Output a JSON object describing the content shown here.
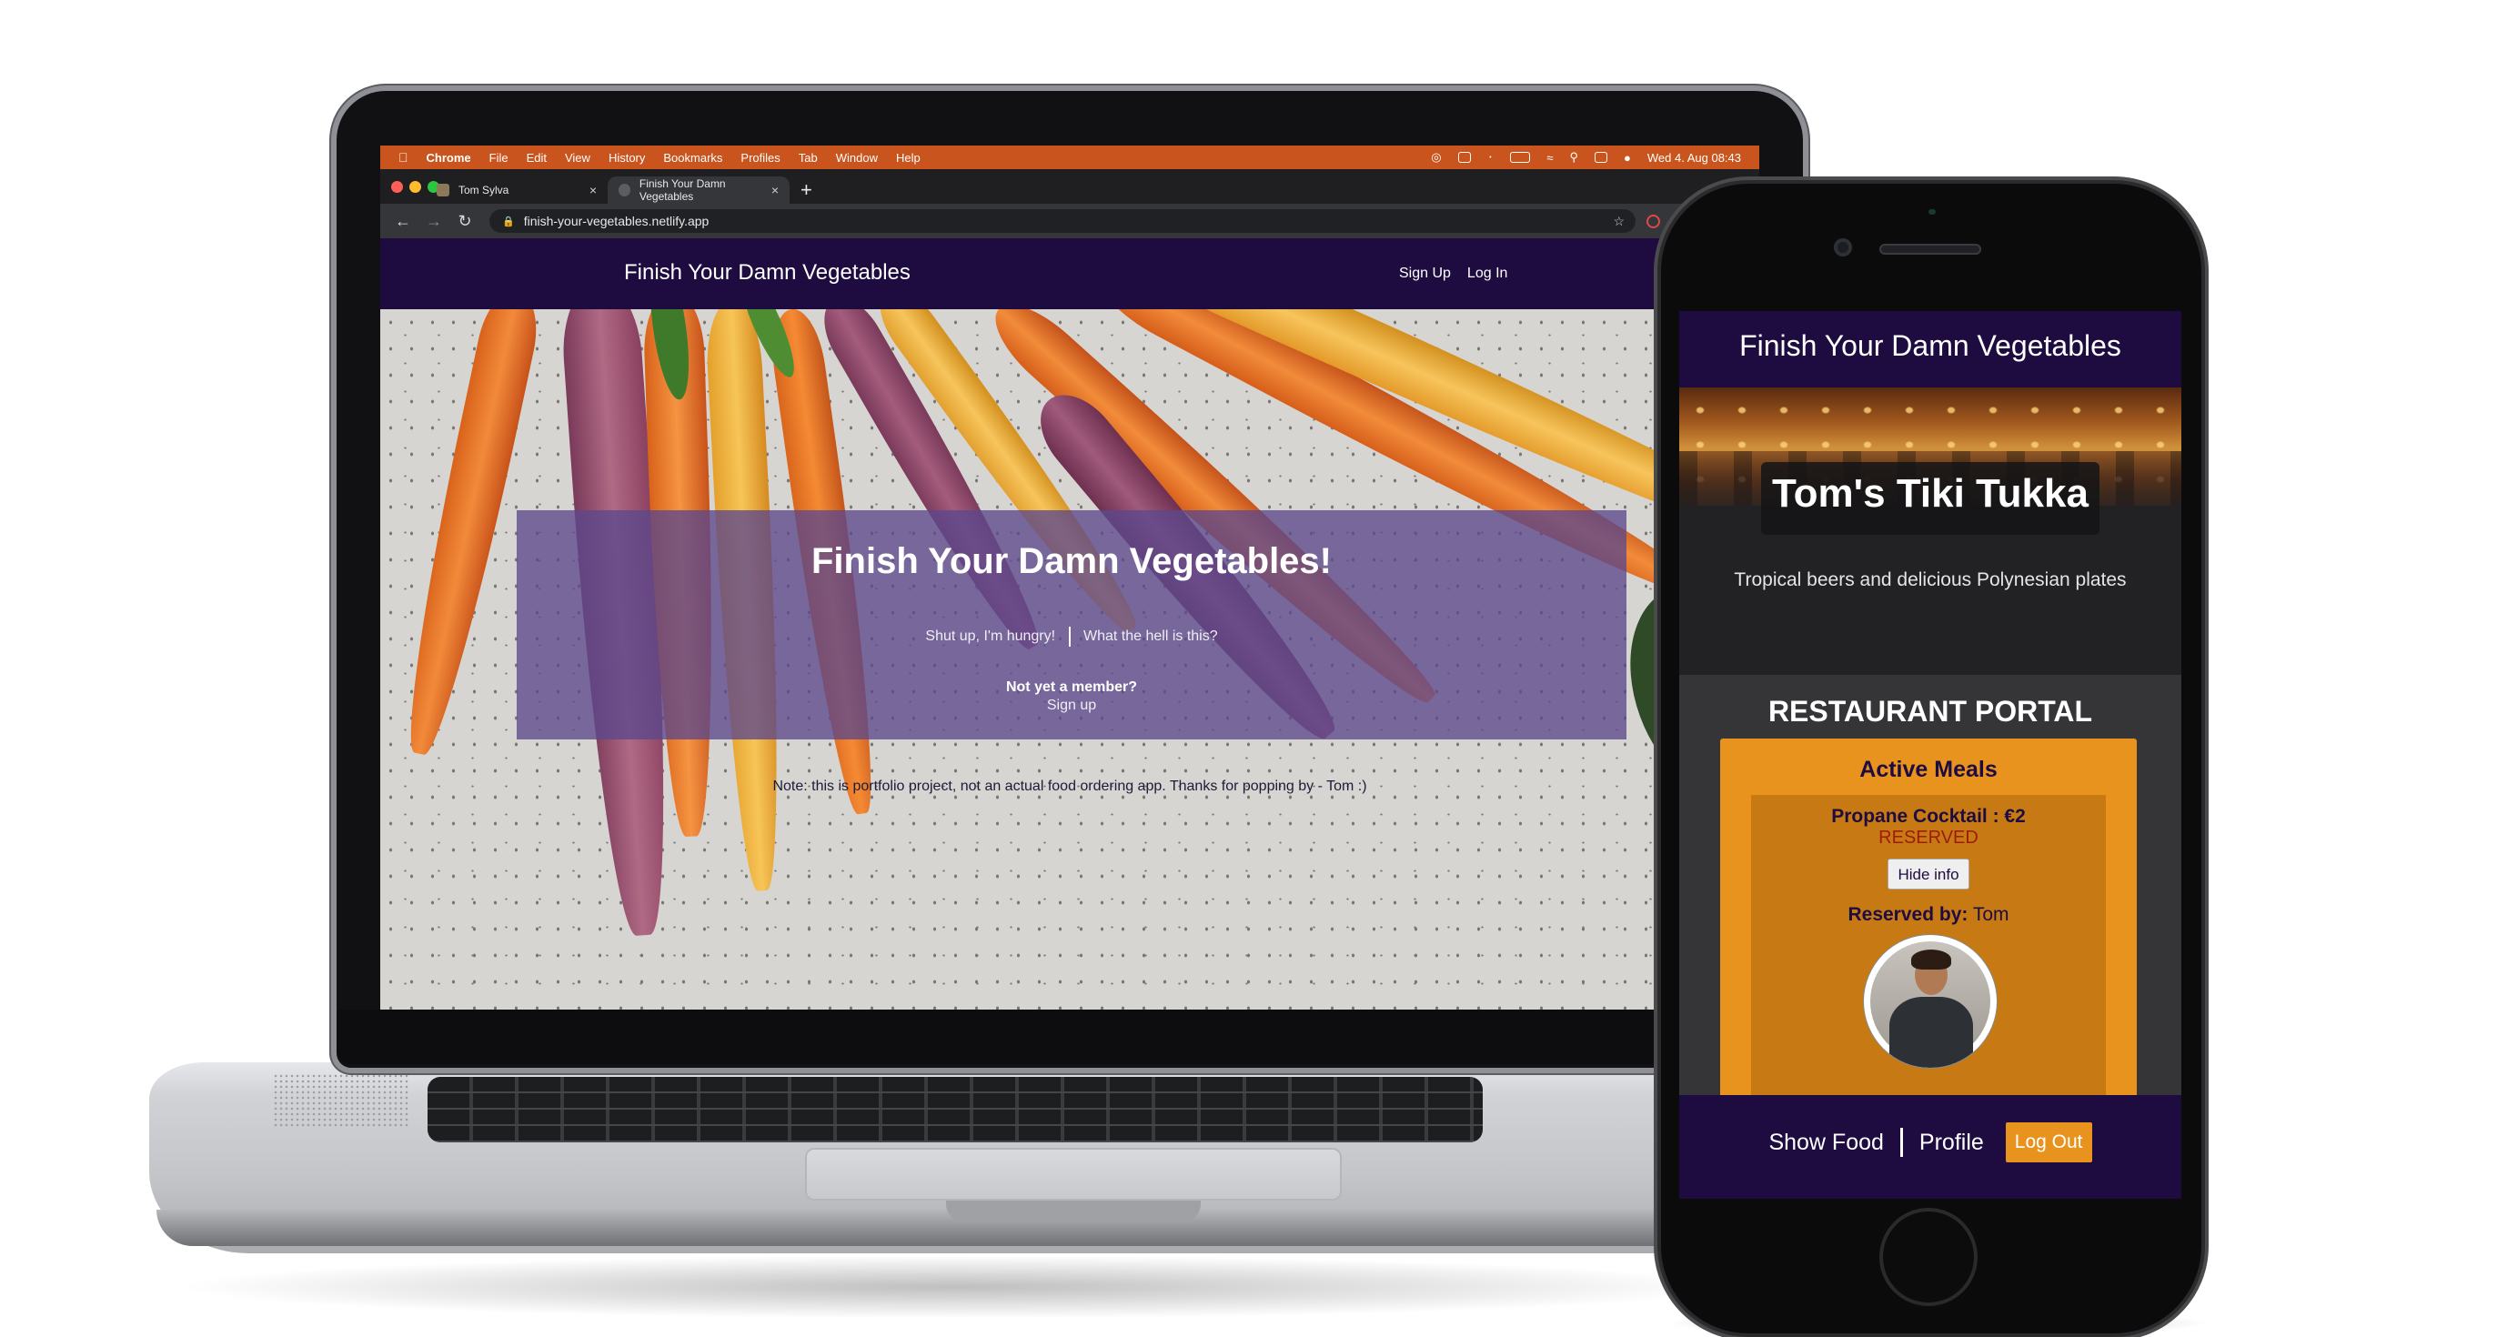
{
  "menubar": {
    "items": [
      "Chrome",
      "File",
      "Edit",
      "View",
      "History",
      "Bookmarks",
      "Profiles",
      "Tab",
      "Window",
      "Help"
    ],
    "datetime": "Wed 4. Aug  08:43"
  },
  "tabs": [
    {
      "title": "Tom Sylva",
      "close": "×"
    },
    {
      "title": "Finish Your Damn Vegetables",
      "close": "×"
    }
  ],
  "new_tab": "+",
  "address_bar": {
    "url": "finish-your-vegetables.netlify.app"
  },
  "site": {
    "title": "Finish Your Damn Vegetables",
    "nav": {
      "signup": "Sign Up",
      "login": "Log In"
    },
    "hero": {
      "heading": "Finish Your Damn Vegetables!",
      "link1": "Shut up, I'm hungry!",
      "link2": "What the hell is this?",
      "member_prompt": "Not yet a member?",
      "signup_link": "Sign up",
      "note": "Note: this is portfolio project, not an actual food ordering app. Thanks for popping by - Tom :)"
    }
  },
  "phone": {
    "header_title": "Finish Your Damn Vegetables",
    "restaurant_name": "Tom's Tiki Tukka",
    "tagline": "Tropical beers and delicious Polynesian plates",
    "portal_title": "RESTAURANT PORTAL",
    "active_meals_title": "Active Meals",
    "meal": {
      "name": "Propane Cocktail : €2",
      "status": "RESERVED",
      "hide_button": "Hide info",
      "reserved_by_label": "Reserved by:",
      "reserved_by_name": "Tom"
    },
    "bottom_nav": {
      "show_food": "Show Food",
      "profile": "Profile",
      "logout": "Log Out"
    }
  },
  "colors": {
    "brand_purple": "#1e0c40",
    "accent_orange": "#e9931f",
    "menubar_orange": "#c9541d",
    "reserved_red": "#9e1b0b"
  }
}
